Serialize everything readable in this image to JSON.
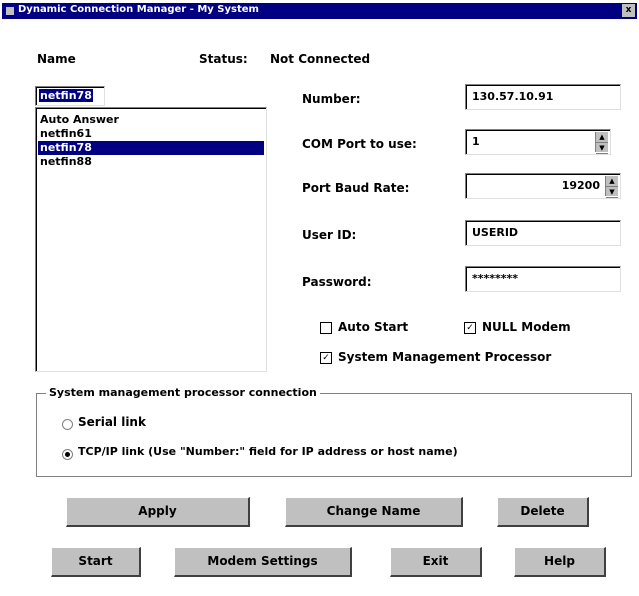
{
  "window": {
    "title": "Dynamic Connection Manager - My System",
    "close_glyph": "x"
  },
  "header": {
    "name_label": "Name",
    "status_label": "Status:",
    "status_value": "Not Connected"
  },
  "name_field": {
    "value": "netfin78"
  },
  "list": {
    "items": [
      "Auto Answer",
      "netfin61",
      "netfin78",
      "netfin88"
    ],
    "selected_index": 2
  },
  "fields": {
    "number": {
      "label": "Number:",
      "value": "130.57.10.91"
    },
    "com_port": {
      "label": "COM Port to use:",
      "value": "1"
    },
    "baud_rate": {
      "label": "Port Baud Rate:",
      "value": "19200"
    },
    "user_id": {
      "label": "User ID:",
      "value": "USERID"
    },
    "password": {
      "label": "Password:",
      "value": "********"
    }
  },
  "checkboxes": {
    "auto_start": {
      "label": "Auto Start",
      "checked": false,
      "mark": ""
    },
    "null_modem": {
      "label": "NULL Modem",
      "checked": true,
      "mark": "✓"
    },
    "smp": {
      "label": "System Management Processor",
      "checked": true,
      "mark": "✓"
    }
  },
  "smp_group": {
    "title": "System management processor connection",
    "serial": {
      "label": "Serial link",
      "selected": false
    },
    "tcpip": {
      "label": "TCP/IP link (Use \"Number:\" field for IP address or host name)",
      "selected": true
    }
  },
  "buttons": {
    "apply": "Apply",
    "change_name": "Change Name",
    "delete": "Delete",
    "start": "Start",
    "modem_settings": "Modem Settings",
    "exit": "Exit",
    "help": "Help"
  },
  "icons": {
    "spin_up": "▲",
    "spin_down": "▼"
  }
}
